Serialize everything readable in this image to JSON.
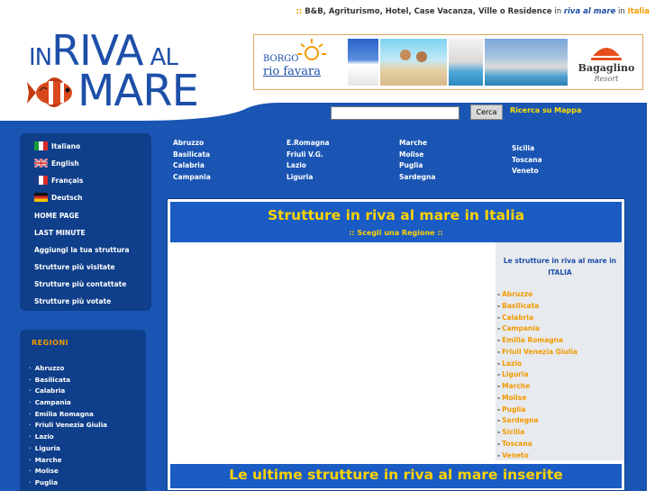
{
  "tagline": {
    "prefix": ":: ",
    "text": "B&B, Agriturismo, Hotel, Case Vacanza, Ville o Residence",
    "in1": " in ",
    "riva": "riva al mare",
    "in2": " in ",
    "italia": "Italia"
  },
  "logo": {
    "in": "IN",
    "riva": "RIVA",
    "al": "AL",
    "mare": "MARE"
  },
  "banner": {
    "borgo_line1": "BORGO",
    "borgo_line2": "rio favara",
    "bag_name": "Bagaglino",
    "bag_sub": "Resort"
  },
  "search": {
    "value": "",
    "button_label": "Cerca",
    "map_link": "Ricerca su Mappa"
  },
  "languages": [
    {
      "label": "Italiano",
      "flag": "it-flag-icon"
    },
    {
      "label": "English",
      "flag": "uk-flag-icon"
    },
    {
      "label": "Français",
      "flag": "fr-flag-icon"
    },
    {
      "label": "Deutsch",
      "flag": "de-flag-icon"
    }
  ],
  "menu": [
    "HOME PAGE",
    "LAST MINUTE",
    "Aggiungi la tua struttura",
    "Strutture più visitate",
    "Strutture più contattate",
    "Strutture più votate"
  ],
  "top_regions": {
    "col1": [
      "Abruzzo",
      "Basilicata",
      "Calabria",
      "Campania"
    ],
    "col2": [
      "E.Romagna",
      "Friuli V.G.",
      "Lazio",
      "Liguria"
    ],
    "col3": [
      "Marche",
      "Molise",
      "Puglia",
      "Sardegna"
    ],
    "col4": [
      "Sicilia",
      "Toscana",
      "Veneto"
    ]
  },
  "regioni": {
    "title": "REGIONI",
    "items": [
      "Abruzzo",
      "Basilicata",
      "Calabria",
      "Campania",
      "Emilia Romagna",
      "Friuli Venezia Giulia",
      "Lazio",
      "Liguria",
      "Marche",
      "Molise",
      "Puglia"
    ]
  },
  "panel": {
    "title": "Strutture in riva al mare in Italia",
    "subtitle": ":: Scegli una Regione ::",
    "side_title": "Le strutture in riva al mare in ITALIA",
    "side_items": [
      "Abruzzo",
      "Basilicata",
      "Calabria",
      "Campania",
      "Emilia Romagna",
      "Friuli Venezia Giulia",
      "Lazio",
      "Liguria",
      "Marche",
      "Molise",
      "Puglia",
      "Sardegna",
      "Sicilia",
      "Toscana",
      "Veneto"
    ],
    "latest_title": "Le ultime strutture in riva al mare inserite"
  },
  "colors": {
    "brand_blue": "#1d4fa8",
    "body_blue": "#1a55b4",
    "dark_blue": "#0f3f8a",
    "accent_orange": "#f29a00",
    "accent_yellow": "#ffd200"
  }
}
